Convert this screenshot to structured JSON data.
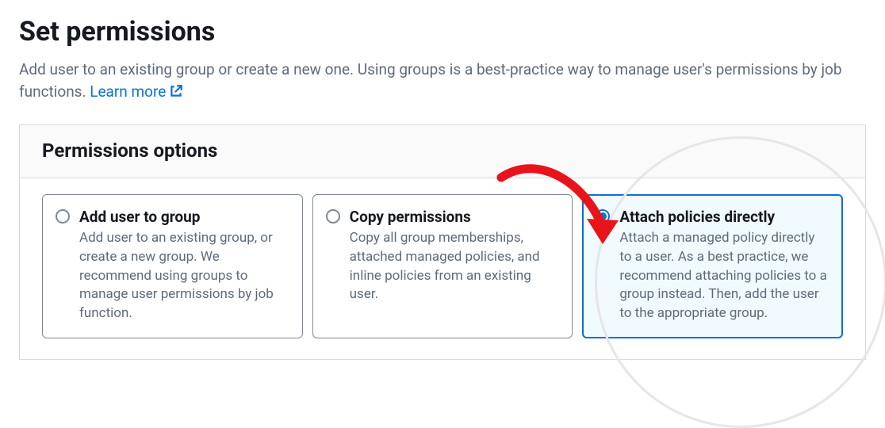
{
  "page": {
    "title": "Set permissions",
    "subtitle": "Add user to an existing group or create a new one. Using groups is a best-practice way to manage user's permissions by job functions. ",
    "learn_more": "Learn more"
  },
  "panel": {
    "heading": "Permissions options"
  },
  "options": {
    "add_to_group": {
      "title": "Add user to group",
      "desc": "Add user to an existing group, or create a new group. We recommend using groups to manage user permissions by job function."
    },
    "copy_permissions": {
      "title": "Copy permissions",
      "desc": "Copy all group memberships, attached managed policies, and inline policies from an existing user."
    },
    "attach_policies": {
      "title": "Attach policies directly",
      "desc": "Attach a managed policy directly to a user. As a best practice, we recommend attaching policies to a group instead. Then, add the user to the appropriate group."
    }
  }
}
